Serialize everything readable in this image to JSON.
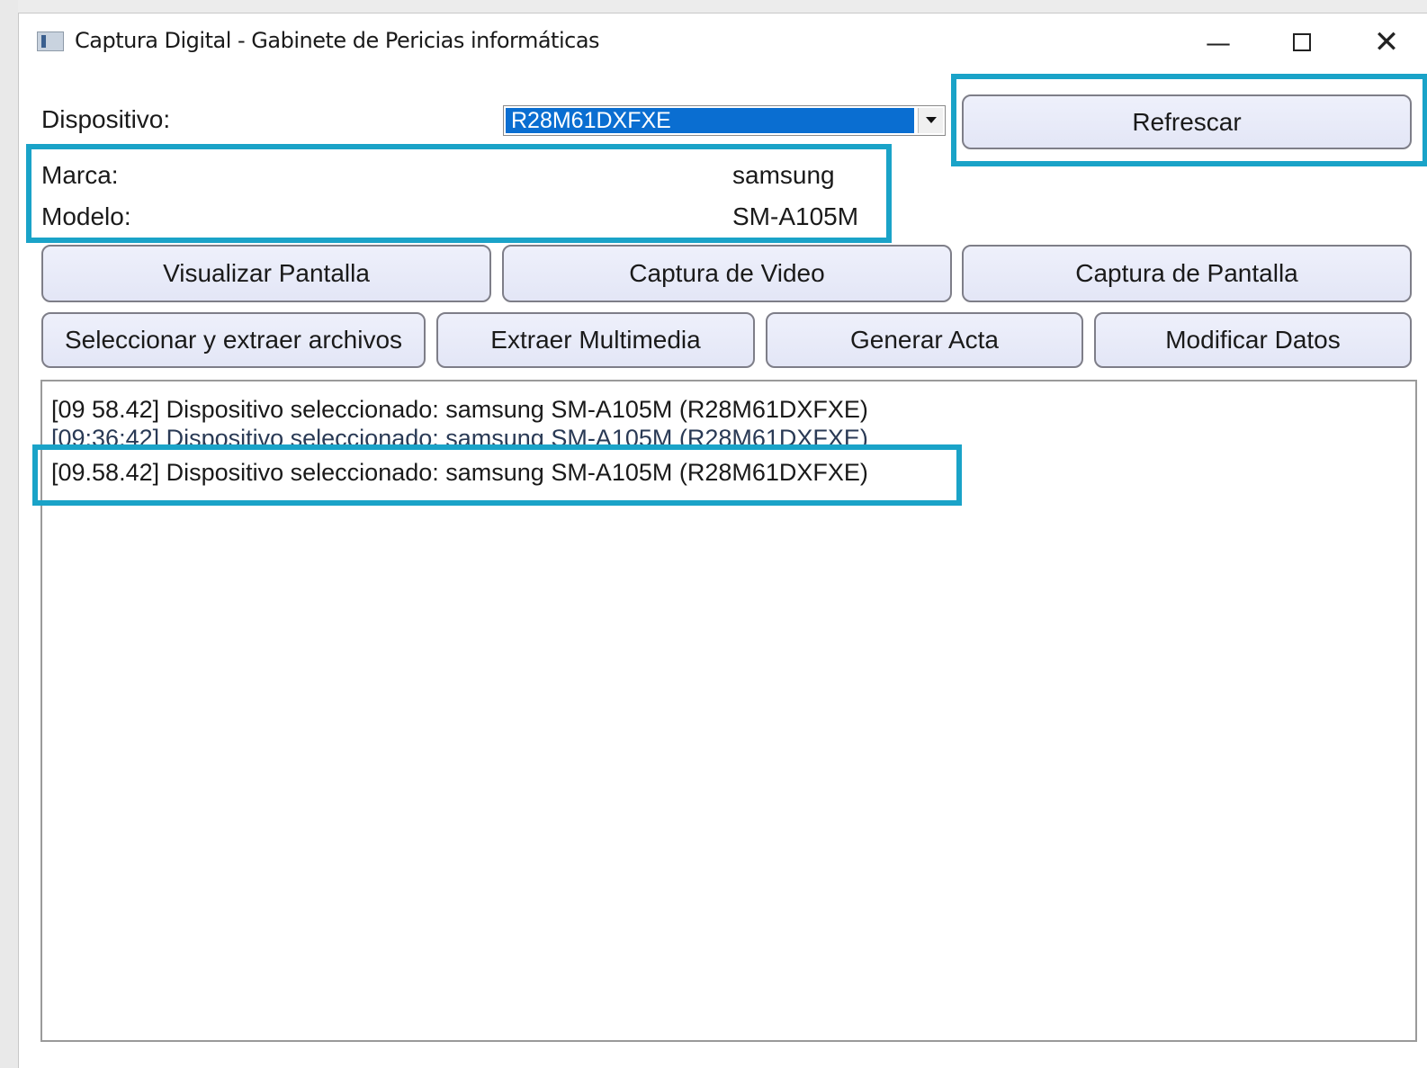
{
  "window": {
    "title": "Captura Digital - Gabinete de Pericias informáticas",
    "minimize_glyph": "—",
    "close_glyph": "✕"
  },
  "device": {
    "label": "Dispositivo:",
    "selected": "R28M61DXFXE"
  },
  "refresh_label": "Refrescar",
  "info": {
    "brand_label": "Marca:",
    "brand_value": "samsung",
    "model_label": "Modelo:",
    "model_value": "SM-A105M"
  },
  "buttons_row1": [
    "Visualizar Pantalla",
    "Captura de Video",
    "Captura de Pantalla"
  ],
  "buttons_row2": [
    "Seleccionar y extraer archivos",
    "Extraer Multimedia",
    "Generar Acta",
    "Modificar Datos"
  ],
  "log": [
    "[09 58.42] Dispositivo seleccionado: samsung SM-A105M (R28M61DXFXE)",
    "[09:36:42] Dispositivo seleccionado: samsung SM-A105M (R28M61DXFXE)",
    "[09.58.42] Dispositivo seleccionado: samsung SM-A105M (R28M61DXFXE)"
  ],
  "colors": {
    "highlight": "#1aa3c8",
    "selection": "#0a6ed1",
    "button_face": "#e6e9f7"
  },
  "icons": {
    "app": "app-window-icon",
    "minimize": "minimize-icon",
    "maximize": "maximize-icon",
    "close": "close-icon",
    "dropdown": "chevron-down-icon"
  }
}
